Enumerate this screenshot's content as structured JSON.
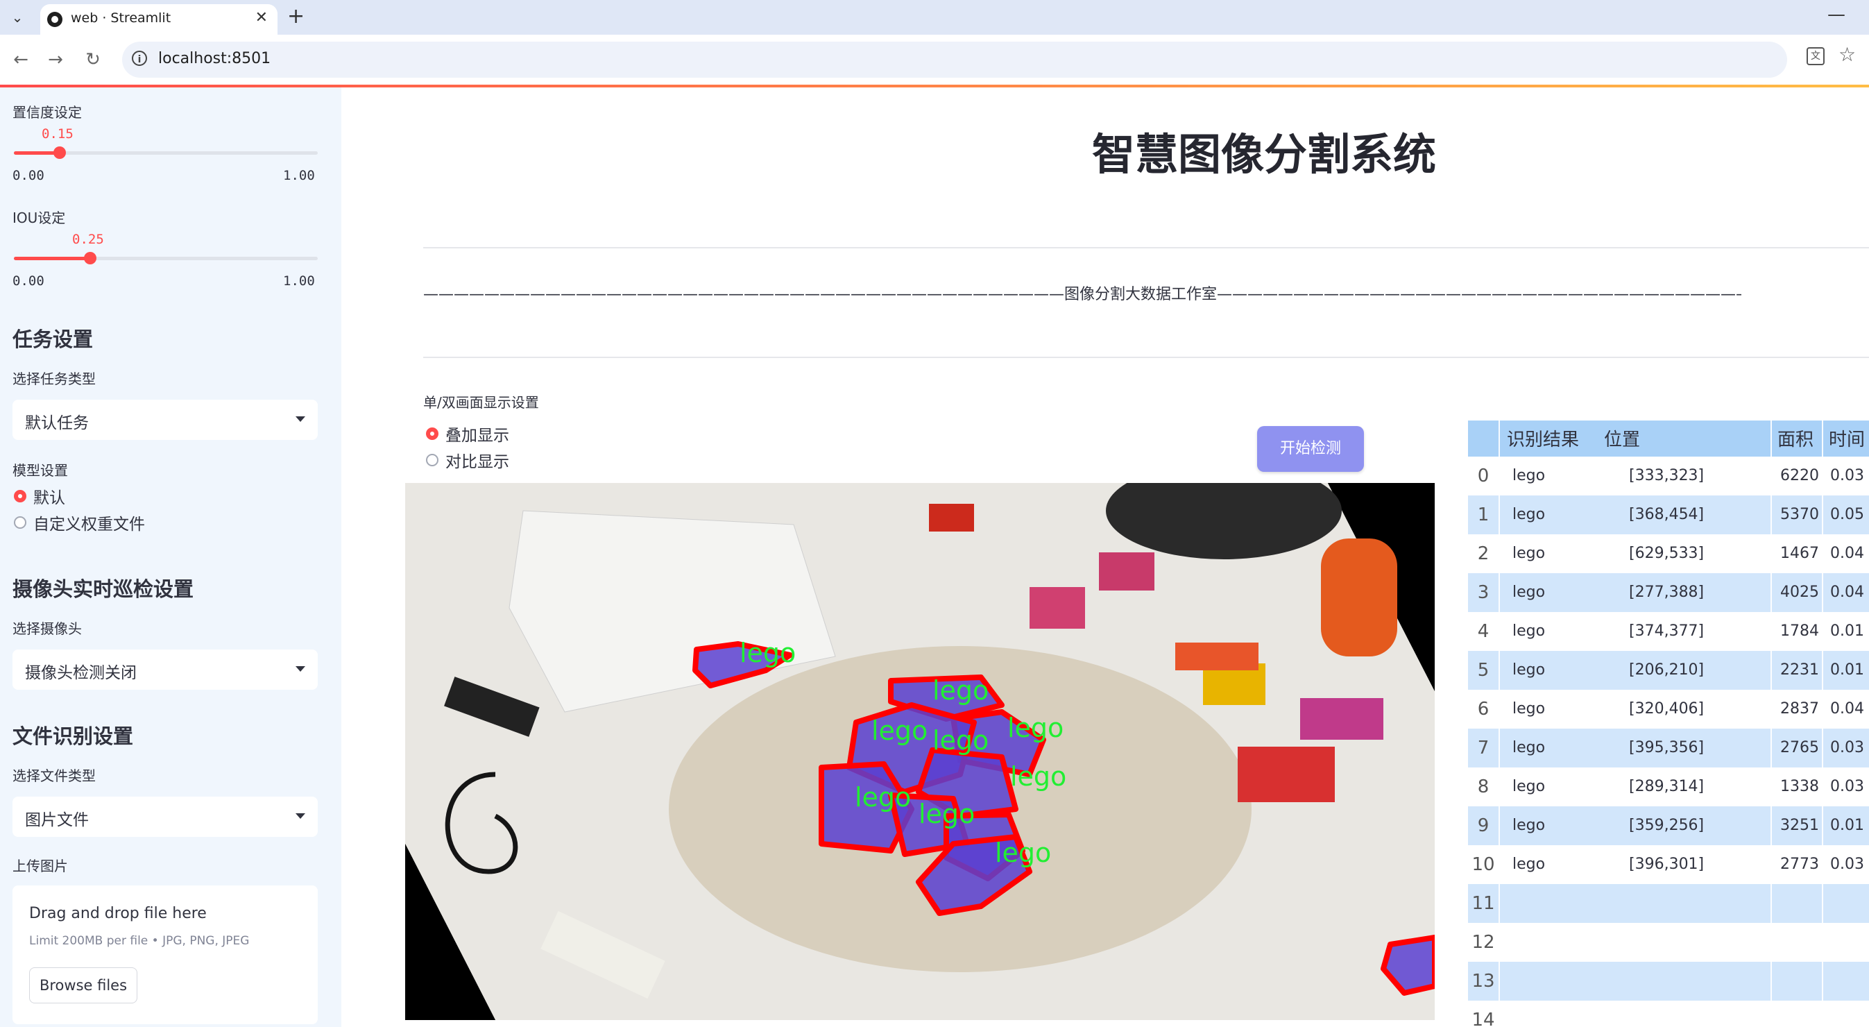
{
  "browser": {
    "tab_title": "web · Streamlit",
    "url": "localhost:8501",
    "new_tab_symbol": "+",
    "close_symbol": "✕",
    "minimize_symbol": "—"
  },
  "sidebar": {
    "confidence": {
      "label": "置信度设定",
      "value": "0.15",
      "min": "0.00",
      "max": "1.00",
      "fraction": 0.15
    },
    "iou": {
      "label": "IOU设定",
      "value": "0.25",
      "min": "0.00",
      "max": "1.00",
      "fraction": 0.25
    },
    "task_header": "任务设置",
    "task_type_label": "选择任务类型",
    "task_type_value": "默认任务",
    "model_label": "模型设置",
    "model_options": [
      "默认",
      "自定义权重文件"
    ],
    "model_selected": 0,
    "camera_header": "摄像头实时巡检设置",
    "camera_label": "选择摄像头",
    "camera_value": "摄像头检测关闭",
    "file_header": "文件识别设置",
    "file_type_label": "选择文件类型",
    "file_type_value": "图片文件",
    "upload_label": "上传图片",
    "upload_title": "Drag and drop file here",
    "upload_limit": "Limit 200MB per file • JPG, PNG, JPEG",
    "upload_button": "Browse files"
  },
  "main": {
    "title": "智慧图像分割系统",
    "subtitle": "——————————————————————————————————————————图像分割大数据工作室———————————————————————————————————————————",
    "display_label": "单/双画面显示设置",
    "display_options": [
      "叠加显示",
      "对比显示"
    ],
    "display_selected": 0,
    "detect_button": "开始检测",
    "detection_label": "lego"
  },
  "table": {
    "headers": [
      "识别结果",
      "位置",
      "面积",
      "时间"
    ],
    "rows": [
      {
        "idx": "0",
        "result": "lego",
        "pos": "[333,323]",
        "area": "6220",
        "time": "0.03"
      },
      {
        "idx": "1",
        "result": "lego",
        "pos": "[368,454]",
        "area": "5370",
        "time": "0.05"
      },
      {
        "idx": "2",
        "result": "lego",
        "pos": "[629,533]",
        "area": "1467",
        "time": "0.04"
      },
      {
        "idx": "3",
        "result": "lego",
        "pos": "[277,388]",
        "area": "4025",
        "time": "0.04"
      },
      {
        "idx": "4",
        "result": "lego",
        "pos": "[374,377]",
        "area": "1784",
        "time": "0.01"
      },
      {
        "idx": "5",
        "result": "lego",
        "pos": "[206,210]",
        "area": "2231",
        "time": "0.01"
      },
      {
        "idx": "6",
        "result": "lego",
        "pos": "[320,406]",
        "area": "2837",
        "time": "0.04"
      },
      {
        "idx": "7",
        "result": "lego",
        "pos": "[395,356]",
        "area": "2765",
        "time": "0.03"
      },
      {
        "idx": "8",
        "result": "lego",
        "pos": "[289,314]",
        "area": "1338",
        "time": "0.03"
      },
      {
        "idx": "9",
        "result": "lego",
        "pos": "[359,256]",
        "area": "3251",
        "time": "0.01"
      },
      {
        "idx": "10",
        "result": "lego",
        "pos": "[396,301]",
        "area": "2773",
        "time": "0.03"
      },
      {
        "idx": "11",
        "result": "",
        "pos": "",
        "area": "",
        "time": ""
      },
      {
        "idx": "12",
        "result": "",
        "pos": "",
        "area": "",
        "time": ""
      },
      {
        "idx": "13",
        "result": "",
        "pos": "",
        "area": "",
        "time": ""
      },
      {
        "idx": "14",
        "result": "",
        "pos": "",
        "area": "",
        "time": ""
      }
    ]
  },
  "colors": {
    "accent": "#ff4b4b",
    "sidebar_bg": "#f0f6fd",
    "button": "#8f92f0",
    "table_header": "#a9d1f7",
    "table_alt": "#d2e6fb",
    "mask_outline": "#ff0000",
    "mask_label": "#00ff33"
  }
}
